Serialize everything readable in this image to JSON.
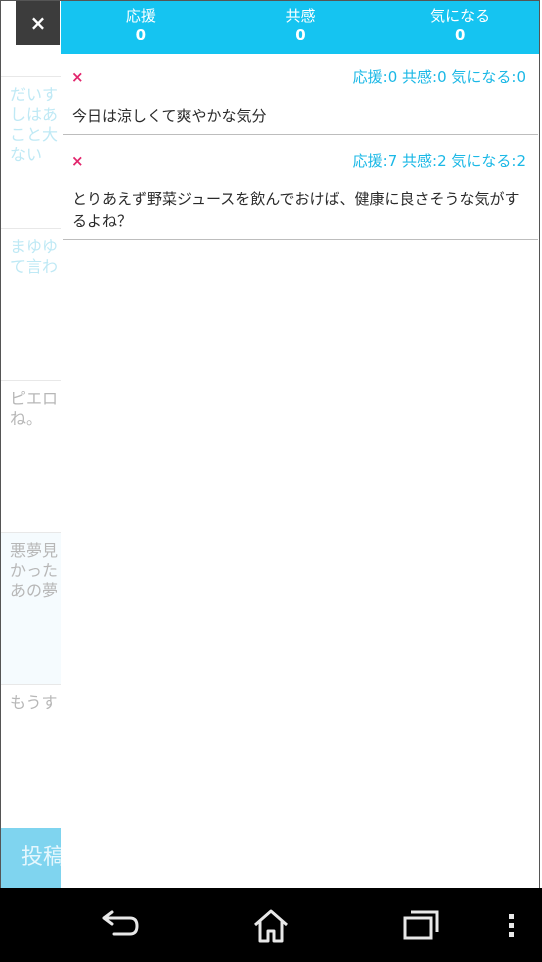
{
  "background_list": {
    "items": [
      {
        "text": "だいす\nしはあ\nこと大\nない"
      },
      {
        "text": "まゆゆ\nて言わ"
      },
      {
        "text": "ピエロ\nね。"
      },
      {
        "text": "悪夢見\nかった\nあの夢"
      },
      {
        "text": "もうす"
      }
    ],
    "post_button_label": "投稿"
  },
  "close_button": {
    "label": "×"
  },
  "header": {
    "stats": [
      {
        "label": "応援",
        "value": "0"
      },
      {
        "label": "共感",
        "value": "0"
      },
      {
        "label": "気になる",
        "value": "0"
      }
    ]
  },
  "entries": [
    {
      "delete_label": "×",
      "counts": "応援:0 共感:0 気になる:0",
      "text": "今日は涼しくて爽やかな気分"
    },
    {
      "delete_label": "×",
      "counts": "応援:7 共感:2 気になる:2",
      "text": "とりあえず野菜ジュースを飲んでおけば、健康に良さそうな気がするよね？"
    }
  ],
  "navbar": {
    "icons": [
      "back-icon",
      "home-icon",
      "recent-apps-icon",
      "menu-icon"
    ]
  },
  "colors": {
    "accent": "#15c4f1",
    "count_text": "#1bb8e6",
    "delete": "#e2266d"
  }
}
